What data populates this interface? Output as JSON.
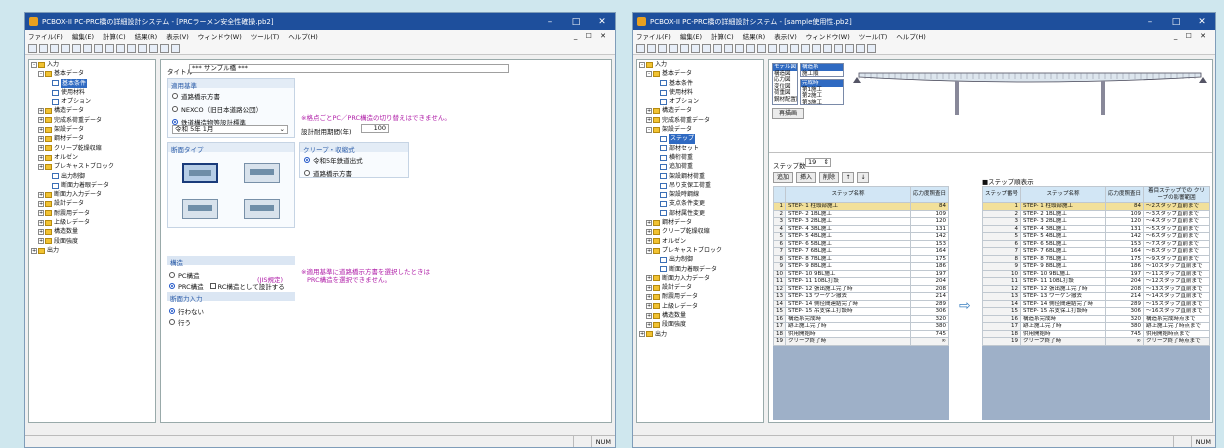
{
  "w1": {
    "title": "PCBOX-II PC-PRC橋の詳細設計システム - [PRCラーメン安全性確操.pb2]",
    "menu": [
      "ファイル(F)",
      "編集(E)",
      "計算(C)",
      "結果(R)",
      "表示(V)",
      "ウィンドウ(W)",
      "ツール(T)",
      "ヘルプ(H)"
    ],
    "tree": [
      {
        "t": "入力",
        "l": 0,
        "k": "f",
        "pm": "-"
      },
      {
        "t": "基本データ",
        "l": 1,
        "k": "f",
        "pm": "-"
      },
      {
        "t": "基本条件",
        "l": 2,
        "k": "d",
        "sel": true
      },
      {
        "t": "使用材料",
        "l": 2,
        "k": "d"
      },
      {
        "t": "オプション",
        "l": 2,
        "k": "d"
      },
      {
        "t": "構造データ",
        "l": 1,
        "k": "f",
        "pm": "+"
      },
      {
        "t": "完成系荷重データ",
        "l": 1,
        "k": "f",
        "pm": "+"
      },
      {
        "t": "架設データ",
        "l": 1,
        "k": "f",
        "pm": "+"
      },
      {
        "t": "鋼材データ",
        "l": 1,
        "k": "f",
        "pm": "+"
      },
      {
        "t": "クリープ乾燥収縮",
        "l": 1,
        "k": "f",
        "pm": "+"
      },
      {
        "t": "オルゼン",
        "l": 1,
        "k": "f",
        "pm": "+"
      },
      {
        "t": "プレキャストブロック",
        "l": 1,
        "k": "f",
        "pm": "+"
      },
      {
        "t": "出力制御",
        "l": 2,
        "k": "d"
      },
      {
        "t": "断面力着眼データ",
        "l": 2,
        "k": "d"
      },
      {
        "t": "断面力入力データ",
        "l": 1,
        "k": "f",
        "pm": "+"
      },
      {
        "t": "設計データ",
        "l": 1,
        "k": "f",
        "pm": "+"
      },
      {
        "t": "耐震用データ",
        "l": 1,
        "k": "f",
        "pm": "+"
      },
      {
        "t": "上級レデータ",
        "l": 1,
        "k": "f",
        "pm": "+"
      },
      {
        "t": "構造数量",
        "l": 1,
        "k": "f",
        "pm": "+"
      },
      {
        "t": "段面強度",
        "l": 1,
        "k": "f",
        "pm": "+"
      },
      {
        "t": "出力",
        "l": 0,
        "k": "f",
        "pm": "+"
      }
    ],
    "form": {
      "title_label": "タイトル",
      "title_value": "*** サンプル橋 ***",
      "std_head": "適用基準",
      "std_opts": [
        "道路橋示方書",
        "NEXCO（旧日本道路公団）",
        "鉄道構造物等設計標準"
      ],
      "era_value": "令和 5年 1月",
      "note1": "※格点ごとPC／PRC構造の切り替えはできません。",
      "life_label": "設計耐用期間(年)",
      "life_value": "100",
      "shape_head": "断面タイプ",
      "creep_head": "クリープ・収縮式",
      "creep_opts": [
        "令和5年鉄道出式",
        "道路橋示方書"
      ],
      "struct_head": "構造",
      "struct_opts": [
        "PC構造",
        "PRC構造"
      ],
      "struct_cb": "RC構造として設計する",
      "jis": "(JIS規定)",
      "note2": "※適用基準に道路橋示方書を選択したときは",
      "note3": "PRC構造を選択できません。",
      "force_head": "断面力入力",
      "force_opts": [
        "行わない",
        "行う"
      ]
    },
    "status": "NUM"
  },
  "w2": {
    "title": "PCBOX-II PC-PRC橋の詳細設計システム - [sample使用性.pb2]",
    "menu": [
      "ファイル(F)",
      "編集(E)",
      "計算(C)",
      "結果(R)",
      "表示(V)",
      "ウィンドウ(W)",
      "ツール(T)",
      "ヘルプ(H)"
    ],
    "tree": [
      {
        "t": "入力",
        "l": 0,
        "k": "f",
        "pm": "-"
      },
      {
        "t": "基本データ",
        "l": 1,
        "k": "f",
        "pm": "-"
      },
      {
        "t": "基本条件",
        "l": 2,
        "k": "d"
      },
      {
        "t": "使用材料",
        "l": 2,
        "k": "d"
      },
      {
        "t": "オプション",
        "l": 2,
        "k": "d"
      },
      {
        "t": "構造データ",
        "l": 1,
        "k": "f",
        "pm": "+"
      },
      {
        "t": "完成系荷重データ",
        "l": 1,
        "k": "f",
        "pm": "+"
      },
      {
        "t": "架設データ",
        "l": 1,
        "k": "f",
        "pm": "-"
      },
      {
        "t": "ステップ",
        "l": 2,
        "k": "d",
        "sel": true
      },
      {
        "t": "部材セット",
        "l": 2,
        "k": "d"
      },
      {
        "t": "横桁荷重",
        "l": 2,
        "k": "d"
      },
      {
        "t": "追加荷重",
        "l": 2,
        "k": "d"
      },
      {
        "t": "架設鋼材荷重",
        "l": 2,
        "k": "d"
      },
      {
        "t": "吊り支保工荷重",
        "l": 2,
        "k": "d"
      },
      {
        "t": "架設時鋼線",
        "l": 2,
        "k": "d"
      },
      {
        "t": "支点条件変更",
        "l": 2,
        "k": "d"
      },
      {
        "t": "部材属性変更",
        "l": 2,
        "k": "d"
      },
      {
        "t": "鋼材データ",
        "l": 1,
        "k": "f",
        "pm": "+"
      },
      {
        "t": "クリープ乾燥収縮",
        "l": 1,
        "k": "f",
        "pm": "+"
      },
      {
        "t": "オルゼン",
        "l": 1,
        "k": "f",
        "pm": "+"
      },
      {
        "t": "プレキャストブロック",
        "l": 1,
        "k": "f",
        "pm": "+"
      },
      {
        "t": "出力制御",
        "l": 2,
        "k": "d"
      },
      {
        "t": "断面力着眼データ",
        "l": 2,
        "k": "d"
      },
      {
        "t": "断面力入力データ",
        "l": 1,
        "k": "f",
        "pm": "+"
      },
      {
        "t": "設計データ",
        "l": 1,
        "k": "f",
        "pm": "+"
      },
      {
        "t": "耐震用データ",
        "l": 1,
        "k": "f",
        "pm": "+"
      },
      {
        "t": "上級レデータ",
        "l": 1,
        "k": "f",
        "pm": "+"
      },
      {
        "t": "構造数量",
        "l": 1,
        "k": "f",
        "pm": "+"
      },
      {
        "t": "段面強度",
        "l": 1,
        "k": "f",
        "pm": "+"
      },
      {
        "t": "出力",
        "l": 0,
        "k": "f",
        "pm": "+"
      }
    ],
    "lists": {
      "a": [
        "モデル図",
        "構造図",
        "応力図",
        "変位図",
        "荷重図",
        "鋼材配置図"
      ],
      "b": [
        "構造系",
        "施工順",
        "格点番号",
        "部材番号"
      ],
      "c": [
        "完成時",
        "第1施工",
        "第2施工",
        "第3施工"
      ]
    },
    "redraw": "再描画",
    "step_label": "ステップ数",
    "step_value": "19",
    "btn_add": "追加",
    "btn_insert": "挿入",
    "btn_delete": "削除",
    "display_title": "■ステップ順表示",
    "th_no": "ステップ番号",
    "th_name": "ステップ名称",
    "th_days": "応力度照査日",
    "th_creep": "着目ステップでの クリープの影響範囲",
    "rows": [
      [
        "1",
        "STEP- 1 柱頭部施工",
        "84",
        "～2スタップ直前まで"
      ],
      [
        "2",
        "STEP- 2 1BL施工",
        "109",
        "～3スタップ直前まで"
      ],
      [
        "3",
        "STEP- 3 2BL施工",
        "120",
        "～4スタップ直前まで"
      ],
      [
        "4",
        "STEP- 4 3BL施工",
        "131",
        "～5スタップ直前まで"
      ],
      [
        "5",
        "STEP- 5 4BL施工",
        "142",
        "～6スタップ直前まで"
      ],
      [
        "6",
        "STEP- 6 5BL施工",
        "153",
        "～7スタップ直前まで"
      ],
      [
        "7",
        "STEP- 7 6BL施工",
        "164",
        "～8スタップ直前まで"
      ],
      [
        "8",
        "STEP- 8 7BL施工",
        "175",
        "～9スタップ直前まで"
      ],
      [
        "9",
        "STEP- 9 8BL施工",
        "186",
        "～10スタップ直前まで"
      ],
      [
        "10",
        "STEP- 10 9BL施工",
        "197",
        "～11スタップ直前まで"
      ],
      [
        "11",
        "STEP- 11 10BL打設",
        "204",
        "～12スタップ直前まで"
      ],
      [
        "12",
        "STEP- 12 張出施工完了時",
        "208",
        "～13スタップ直前まで"
      ],
      [
        "13",
        "STEP- 13 ワーゲン撤去",
        "214",
        "～14スタップ直前まで"
      ],
      [
        "14",
        "STEP- 14 側径間連結完了時",
        "289",
        "～15スタップ直前まで"
      ],
      [
        "15",
        "STEP- 15 吊支保工打設時",
        "306",
        "～16スタップ直前まで"
      ],
      [
        "16",
        "構造系完成時",
        "320",
        "構造系完成時点まで"
      ],
      [
        "17",
        "跡上施工完了時",
        "380",
        "跡上施工完了時点まで"
      ],
      [
        "18",
        "供用開始時",
        "745",
        "供用開始時点まで"
      ],
      [
        "19",
        "クリープ終了時",
        "∞",
        "クリープ終了時点まで"
      ]
    ],
    "status": "NUM"
  }
}
